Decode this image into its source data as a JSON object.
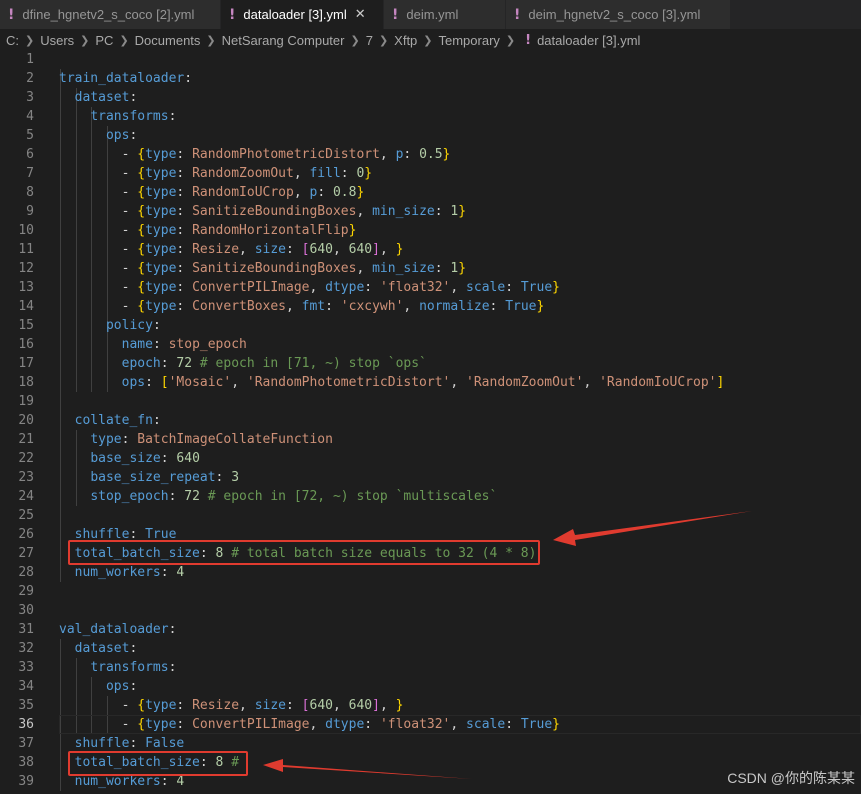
{
  "tabs": [
    {
      "label": "dfine_hgnetv2_s_coco [2].yml",
      "icon": "!",
      "active": false
    },
    {
      "label": "dataloader [3].yml",
      "icon": "!",
      "active": true,
      "close": "✕"
    },
    {
      "label": "deim.yml",
      "icon": "!",
      "active": false
    },
    {
      "label": "deim_hgnetv2_s_coco [3].yml",
      "icon": "!",
      "active": false
    }
  ],
  "breadcrumb": {
    "parts": [
      "C:",
      "Users",
      "PC",
      "Documents",
      "NetSarang Computer",
      "7",
      "Xftp",
      "Temporary"
    ],
    "file": "dataloader [3].yml",
    "file_icon": "!"
  },
  "lines": [
    [],
    [
      [
        "k",
        "train_dataloader"
      ],
      [
        "p",
        ":"
      ]
    ],
    [
      [
        "p",
        "  "
      ],
      [
        "k",
        "dataset"
      ],
      [
        "p",
        ":"
      ]
    ],
    [
      [
        "p",
        "    "
      ],
      [
        "k",
        "transforms"
      ],
      [
        "p",
        ":"
      ]
    ],
    [
      [
        "p",
        "      "
      ],
      [
        "k",
        "ops"
      ],
      [
        "p",
        ":"
      ]
    ],
    [
      [
        "p",
        "        - "
      ],
      [
        "b1",
        "{"
      ],
      [
        "k",
        "type"
      ],
      [
        "p",
        ": "
      ],
      [
        "s",
        "RandomPhotometricDistort"
      ],
      [
        "p",
        ", "
      ],
      [
        "k",
        "p"
      ],
      [
        "p",
        ": "
      ],
      [
        "n",
        "0.5"
      ],
      [
        "b1",
        "}"
      ]
    ],
    [
      [
        "p",
        "        - "
      ],
      [
        "b1",
        "{"
      ],
      [
        "k",
        "type"
      ],
      [
        "p",
        ": "
      ],
      [
        "s",
        "RandomZoomOut"
      ],
      [
        "p",
        ", "
      ],
      [
        "k",
        "fill"
      ],
      [
        "p",
        ": "
      ],
      [
        "n",
        "0"
      ],
      [
        "b1",
        "}"
      ]
    ],
    [
      [
        "p",
        "        - "
      ],
      [
        "b1",
        "{"
      ],
      [
        "k",
        "type"
      ],
      [
        "p",
        ": "
      ],
      [
        "s",
        "RandomIoUCrop"
      ],
      [
        "p",
        ", "
      ],
      [
        "k",
        "p"
      ],
      [
        "p",
        ": "
      ],
      [
        "n",
        "0.8"
      ],
      [
        "b1",
        "}"
      ]
    ],
    [
      [
        "p",
        "        - "
      ],
      [
        "b1",
        "{"
      ],
      [
        "k",
        "type"
      ],
      [
        "p",
        ": "
      ],
      [
        "s",
        "SanitizeBoundingBoxes"
      ],
      [
        "p",
        ", "
      ],
      [
        "k",
        "min_size"
      ],
      [
        "p",
        ": "
      ],
      [
        "n",
        "1"
      ],
      [
        "b1",
        "}"
      ]
    ],
    [
      [
        "p",
        "        - "
      ],
      [
        "b1",
        "{"
      ],
      [
        "k",
        "type"
      ],
      [
        "p",
        ": "
      ],
      [
        "s",
        "RandomHorizontalFlip"
      ],
      [
        "b1",
        "}"
      ]
    ],
    [
      [
        "p",
        "        - "
      ],
      [
        "b1",
        "{"
      ],
      [
        "k",
        "type"
      ],
      [
        "p",
        ": "
      ],
      [
        "s",
        "Resize"
      ],
      [
        "p",
        ", "
      ],
      [
        "k",
        "size"
      ],
      [
        "p",
        ": "
      ],
      [
        "b2",
        "["
      ],
      [
        "n",
        "640"
      ],
      [
        "p",
        ", "
      ],
      [
        "n",
        "640"
      ],
      [
        "b2",
        "]"
      ],
      [
        "p",
        ", "
      ],
      [
        "b1",
        "}"
      ]
    ],
    [
      [
        "p",
        "        - "
      ],
      [
        "b1",
        "{"
      ],
      [
        "k",
        "type"
      ],
      [
        "p",
        ": "
      ],
      [
        "s",
        "SanitizeBoundingBoxes"
      ],
      [
        "p",
        ", "
      ],
      [
        "k",
        "min_size"
      ],
      [
        "p",
        ": "
      ],
      [
        "n",
        "1"
      ],
      [
        "b1",
        "}"
      ]
    ],
    [
      [
        "p",
        "        - "
      ],
      [
        "b1",
        "{"
      ],
      [
        "k",
        "type"
      ],
      [
        "p",
        ": "
      ],
      [
        "s",
        "ConvertPILImage"
      ],
      [
        "p",
        ", "
      ],
      [
        "k",
        "dtype"
      ],
      [
        "p",
        ": "
      ],
      [
        "s",
        "'float32'"
      ],
      [
        "p",
        ", "
      ],
      [
        "k",
        "scale"
      ],
      [
        "p",
        ": "
      ],
      [
        "k",
        "True"
      ],
      [
        "b1",
        "}"
      ]
    ],
    [
      [
        "p",
        "        - "
      ],
      [
        "b1",
        "{"
      ],
      [
        "k",
        "type"
      ],
      [
        "p",
        ": "
      ],
      [
        "s",
        "ConvertBoxes"
      ],
      [
        "p",
        ", "
      ],
      [
        "k",
        "fmt"
      ],
      [
        "p",
        ": "
      ],
      [
        "s",
        "'cxcywh'"
      ],
      [
        "p",
        ", "
      ],
      [
        "k",
        "normalize"
      ],
      [
        "p",
        ": "
      ],
      [
        "k",
        "True"
      ],
      [
        "b1",
        "}"
      ]
    ],
    [
      [
        "p",
        "      "
      ],
      [
        "k",
        "policy"
      ],
      [
        "p",
        ":"
      ]
    ],
    [
      [
        "p",
        "        "
      ],
      [
        "k",
        "name"
      ],
      [
        "p",
        ": "
      ],
      [
        "s",
        "stop_epoch"
      ]
    ],
    [
      [
        "p",
        "        "
      ],
      [
        "k",
        "epoch"
      ],
      [
        "p",
        ": "
      ],
      [
        "n",
        "72"
      ],
      [
        "c",
        " # epoch in [71, ~) stop `ops`"
      ]
    ],
    [
      [
        "p",
        "        "
      ],
      [
        "k",
        "ops"
      ],
      [
        "p",
        ": "
      ],
      [
        "b1",
        "["
      ],
      [
        "s",
        "'Mosaic'"
      ],
      [
        "p",
        ", "
      ],
      [
        "s",
        "'RandomPhotometricDistort'"
      ],
      [
        "p",
        ", "
      ],
      [
        "s",
        "'RandomZoomOut'"
      ],
      [
        "p",
        ", "
      ],
      [
        "s",
        "'RandomIoUCrop'"
      ],
      [
        "b1",
        "]"
      ]
    ],
    [],
    [
      [
        "p",
        "  "
      ],
      [
        "k",
        "collate_fn"
      ],
      [
        "p",
        ":"
      ]
    ],
    [
      [
        "p",
        "    "
      ],
      [
        "k",
        "type"
      ],
      [
        "p",
        ": "
      ],
      [
        "s",
        "BatchImageCollateFunction"
      ]
    ],
    [
      [
        "p",
        "    "
      ],
      [
        "k",
        "base_size"
      ],
      [
        "p",
        ": "
      ],
      [
        "n",
        "640"
      ]
    ],
    [
      [
        "p",
        "    "
      ],
      [
        "k",
        "base_size_repeat"
      ],
      [
        "p",
        ": "
      ],
      [
        "n",
        "3"
      ]
    ],
    [
      [
        "p",
        "    "
      ],
      [
        "k",
        "stop_epoch"
      ],
      [
        "p",
        ": "
      ],
      [
        "n",
        "72"
      ],
      [
        "c",
        " # epoch in [72, ~) stop `multiscales`"
      ]
    ],
    [],
    [
      [
        "p",
        "  "
      ],
      [
        "k",
        "shuffle"
      ],
      [
        "p",
        ": "
      ],
      [
        "k",
        "True"
      ]
    ],
    [
      [
        "p",
        "  "
      ],
      [
        "k",
        "total_batch_size"
      ],
      [
        "p",
        ": "
      ],
      [
        "n",
        "8"
      ],
      [
        "c",
        " # total batch size equals to 32 (4 * 8)"
      ]
    ],
    [
      [
        "p",
        "  "
      ],
      [
        "k",
        "num_workers"
      ],
      [
        "p",
        ": "
      ],
      [
        "n",
        "4"
      ]
    ],
    [],
    [],
    [
      [
        "k",
        "val_dataloader"
      ],
      [
        "p",
        ":"
      ]
    ],
    [
      [
        "p",
        "  "
      ],
      [
        "k",
        "dataset"
      ],
      [
        "p",
        ":"
      ]
    ],
    [
      [
        "p",
        "    "
      ],
      [
        "k",
        "transforms"
      ],
      [
        "p",
        ":"
      ]
    ],
    [
      [
        "p",
        "      "
      ],
      [
        "k",
        "ops"
      ],
      [
        "p",
        ":"
      ]
    ],
    [
      [
        "p",
        "        - "
      ],
      [
        "b1",
        "{"
      ],
      [
        "k",
        "type"
      ],
      [
        "p",
        ": "
      ],
      [
        "s",
        "Resize"
      ],
      [
        "p",
        ", "
      ],
      [
        "k",
        "size"
      ],
      [
        "p",
        ": "
      ],
      [
        "b2",
        "["
      ],
      [
        "n",
        "640"
      ],
      [
        "p",
        ", "
      ],
      [
        "n",
        "640"
      ],
      [
        "b2",
        "]"
      ],
      [
        "p",
        ", "
      ],
      [
        "b1",
        "}"
      ]
    ],
    [
      [
        "p",
        "        - "
      ],
      [
        "b1",
        "{"
      ],
      [
        "k",
        "type"
      ],
      [
        "p",
        ": "
      ],
      [
        "s",
        "ConvertPILImage"
      ],
      [
        "p",
        ", "
      ],
      [
        "k",
        "dtype"
      ],
      [
        "p",
        ": "
      ],
      [
        "s",
        "'float32'"
      ],
      [
        "p",
        ", "
      ],
      [
        "k",
        "scale"
      ],
      [
        "p",
        ": "
      ],
      [
        "k",
        "True"
      ],
      [
        "b1",
        "}"
      ]
    ],
    [
      [
        "p",
        "  "
      ],
      [
        "k",
        "shuffle"
      ],
      [
        "p",
        ": "
      ],
      [
        "k",
        "False"
      ]
    ],
    [
      [
        "p",
        "  "
      ],
      [
        "k",
        "total_batch_size"
      ],
      [
        "p",
        ": "
      ],
      [
        "n",
        "8"
      ],
      [
        "c",
        " #"
      ]
    ],
    [
      [
        "p",
        "  "
      ],
      [
        "k",
        "num_workers"
      ],
      [
        "p",
        ": "
      ],
      [
        "n",
        "4"
      ]
    ]
  ],
  "current_line": 36,
  "watermark": "CSDN @你的陈某某",
  "colors": {
    "background": "#1e1e1e",
    "key": "#569cd6",
    "string": "#ce9178",
    "number": "#b5cea8",
    "comment": "#6a9955",
    "bracket_gold": "#ffd700",
    "bracket_magenta": "#da70d6",
    "yaml_icon": "#c586c0",
    "annotation_red": "#e03b2f"
  }
}
